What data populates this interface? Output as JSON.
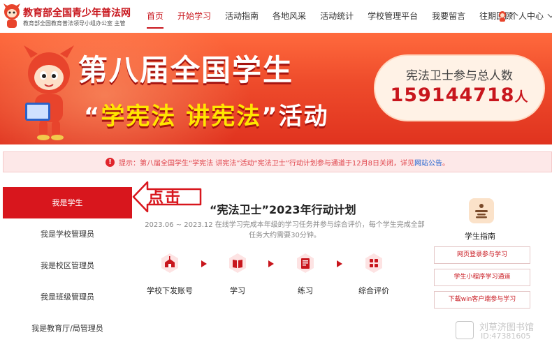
{
  "header": {
    "site_title": "教育部全国青少年普法网",
    "site_subtitle": "教育部全国教育普法领导小组办公室 主管",
    "nav": [
      "首页",
      "开始学习",
      "活动指南",
      "各地风采",
      "活动统计",
      "学校管理平台",
      "我要留言",
      "往期回顾"
    ],
    "user_center": "个人中心",
    "active_color": "#c8161d"
  },
  "banner": {
    "title_line1": "第八届全国学生",
    "title_line2_q1": "“",
    "title_line2_a": "学宪法",
    "title_line2_b": "讲宪法",
    "title_line2_q2": "”",
    "title_line2_c": "活动",
    "count_label": "宪法卫士参与总人数",
    "count_value": "159144718",
    "count_unit": "人"
  },
  "notice": {
    "text": "提示：第八届全国学生“学宪法 讲宪法”活动“宪法卫士”行动计划参与通道于12月8日关闭，详见",
    "link": "网站公告",
    "end": "。"
  },
  "sidebar": {
    "items": [
      "我是学生",
      "我是学校管理员",
      "我是校区管理员",
      "我是班级管理员",
      "我是教育厅/局管理员"
    ]
  },
  "callout": {
    "text": "点击"
  },
  "plan": {
    "title": "“宪法卫士”2023年行动计划",
    "desc": "2023.06 ~ 2023.12 在线学习完成本年级的学习任务并参与综合评价，每个学生完成全部任务大约需要30分钟。",
    "steps": [
      "学校下发账号",
      "学习",
      "练习",
      "综合评价"
    ]
  },
  "guide": {
    "title": "学生指南",
    "buttons": [
      "网页登录参与学习",
      "学生小程序学习通道",
      "下载win客户端参与学习"
    ]
  },
  "watermark": {
    "line1": "刘草济图书馆",
    "line2": "ID:47381605"
  }
}
